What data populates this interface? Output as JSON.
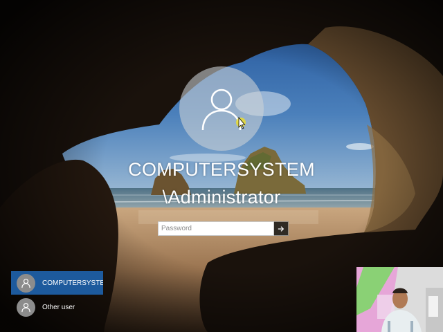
{
  "login": {
    "user_line1": "COMPUTERSYSTEM",
    "user_line2": "\\Administrator",
    "password_placeholder": "Password",
    "submit_icon": "arrow-right-icon",
    "avatar_icon": "user-icon"
  },
  "user_switcher": {
    "items": [
      {
        "label": "COMPUTERSYSTE...",
        "selected": true,
        "icon": "user-icon"
      },
      {
        "label": "Other user",
        "selected": false,
        "icon": "user-icon"
      }
    ]
  },
  "colors": {
    "selected_user": "#1d5a9d",
    "sky": "#3f73b0",
    "sand": "#a8815a",
    "cave_rock": "#2e2218"
  }
}
